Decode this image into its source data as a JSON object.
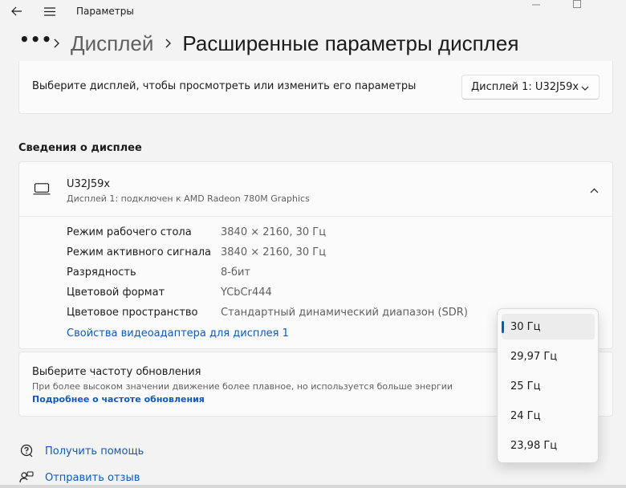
{
  "window": {
    "title": "Параметры",
    "controls": [
      "minimize-icon",
      "maximize-icon"
    ]
  },
  "breadcrumb": {
    "more": "•••",
    "parent": "Дисплей",
    "current": "Расширенные параметры дисплея"
  },
  "display_select": {
    "label": "Выберите дисплей, чтобы просмотреть или изменить его параметры",
    "value": "Дисплей 1: U32J59x"
  },
  "display_info": {
    "section_title": "Сведения о дисплее",
    "name": "U32J59x",
    "subtitle": "Дисплей 1: подключен к AMD Radeon 780M Graphics",
    "rows": [
      {
        "label": "Режим рабочего стола",
        "value": "3840 × 2160, 30 Гц"
      },
      {
        "label": "Режим активного сигнала",
        "value": "3840 × 2160, 30 Гц"
      },
      {
        "label": "Разрядность",
        "value": "8-бит"
      },
      {
        "label": "Цветовой формат",
        "value": "YCbCr444"
      },
      {
        "label": "Цветовое пространство",
        "value": "Стандартный динамический диапазон (SDR)"
      }
    ],
    "adapter_link": "Свойства видеоадаптера для дисплея 1"
  },
  "refresh": {
    "title": "Выберите частоту обновления",
    "description": "При более высоком значении движение более плавное, но используется больше энергии",
    "link": "Подробнее о частоте обновления",
    "options": [
      "30 Гц",
      "29,97 Гц",
      "25 Гц",
      "24 Гц",
      "23,98 Гц"
    ],
    "selected": "30 Гц"
  },
  "footer": {
    "help": "Получить помощь",
    "feedback": "Отправить отзыв"
  },
  "colors": {
    "accent": "#005fb8",
    "link": "#0f5ab8",
    "background": "#f3f3f3",
    "card": "#fbfbfb"
  }
}
